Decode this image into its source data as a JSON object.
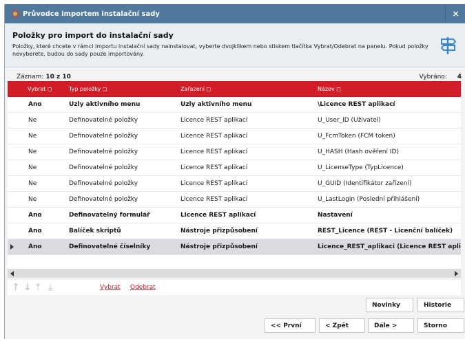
{
  "window": {
    "title": "Průvodce importem instalační sady",
    "close_label": "×"
  },
  "header": {
    "title": "Položky pro import do instalační sady",
    "description": "Položky, které chcete v rámci importu instalační sady nainstalovat, vyberte dvojklikem nebo stiskem tlačítka Vybrat/Odebrat na panelu. Pokud položky nevyberete, budou do sady pouze importovány."
  },
  "counts": {
    "records_label": "Záznam:",
    "records_value": "10 z 10",
    "selected_label": "Vybráno:",
    "selected_value": "4"
  },
  "grid": {
    "columns": [
      "Vybrat ◻",
      "Typ položky ◻",
      "Zařazení ◻",
      "Název ◻"
    ],
    "rows": [
      {
        "selected": "Ano",
        "type": "Uzly aktivního menu",
        "category": "Uzly aktivního menu",
        "name": "\\Licence REST aplikací",
        "bold": true
      },
      {
        "selected": "Ne",
        "type": "Definovatelné položky",
        "category": "Licence REST aplikací",
        "name": "U_User_ID (Uživatel)",
        "bold": false
      },
      {
        "selected": "Ne",
        "type": "Definovatelné položky",
        "category": "Licence REST aplikací",
        "name": "U_FcmToken (FCM token)",
        "bold": false
      },
      {
        "selected": "Ne",
        "type": "Definovatelné položky",
        "category": "Licence REST aplikací",
        "name": "U_HASH (Hash ověření ID)",
        "bold": false
      },
      {
        "selected": "Ne",
        "type": "Definovatelné položky",
        "category": "Licence REST aplikací",
        "name": "U_LicenseType (TypLicence)",
        "bold": false
      },
      {
        "selected": "Ne",
        "type": "Definovatelné položky",
        "category": "Licence REST aplikací",
        "name": "U_GUID (Identifikátor zařízení)",
        "bold": false
      },
      {
        "selected": "Ne",
        "type": "Definovatelné položky",
        "category": "Licence REST aplikací",
        "name": "U_LastLogin (Poslední přihlášení)",
        "bold": false
      },
      {
        "selected": "Ano",
        "type": "Definovatelný formulář",
        "category": "Licence REST aplikací",
        "name": "Nastavení",
        "bold": true
      },
      {
        "selected": "Ano",
        "type": "Balíček skriptů",
        "category": "Nástroje přizpůsobení",
        "name": "REST_Licence (REST - Licenční balíček)",
        "bold": true
      },
      {
        "selected": "Ano",
        "type": "Definovatelné číselníky",
        "category": "Nástroje přizpůsobení",
        "name": "Licence_REST_aplikaci (Licence REST aplikací)",
        "bold": true
      }
    ]
  },
  "toolbar": {
    "select_label": "Vybrat",
    "remove_label": "Odebrat"
  },
  "buttons": {
    "news": "Novinky",
    "history": "Historie",
    "first": "<< První",
    "back": "< Zpět",
    "next": "Dále >",
    "cancel": "Storno"
  },
  "colors": {
    "titlebar": "#4f7a9e",
    "grid_header": "#d21d28",
    "link": "#c0222c"
  }
}
